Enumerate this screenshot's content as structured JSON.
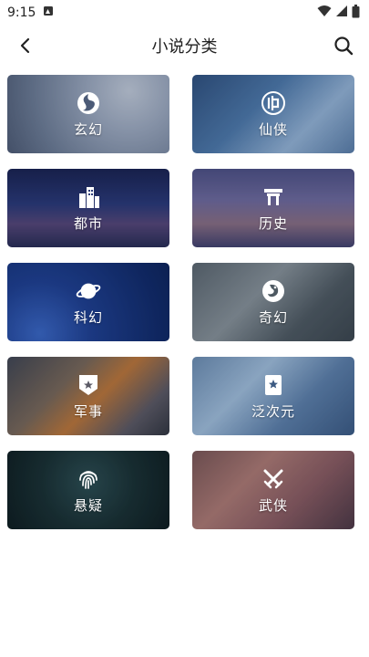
{
  "status": {
    "time": "9:15"
  },
  "header": {
    "title": "小说分类"
  },
  "categories": [
    {
      "label": "玄幻",
      "icon": "taiji-swirl-icon"
    },
    {
      "label": "仙侠",
      "icon": "xian-emblem-icon"
    },
    {
      "label": "都市",
      "icon": "city-buildings-icon"
    },
    {
      "label": "历史",
      "icon": "ancient-gate-icon"
    },
    {
      "label": "科幻",
      "icon": "planet-icon"
    },
    {
      "label": "奇幻",
      "icon": "dragon-emblem-icon"
    },
    {
      "label": "军事",
      "icon": "military-badge-icon"
    },
    {
      "label": "泛次元",
      "icon": "star-card-icon"
    },
    {
      "label": "悬疑",
      "icon": "fingerprint-icon"
    },
    {
      "label": "武侠",
      "icon": "crossed-swords-icon"
    }
  ]
}
